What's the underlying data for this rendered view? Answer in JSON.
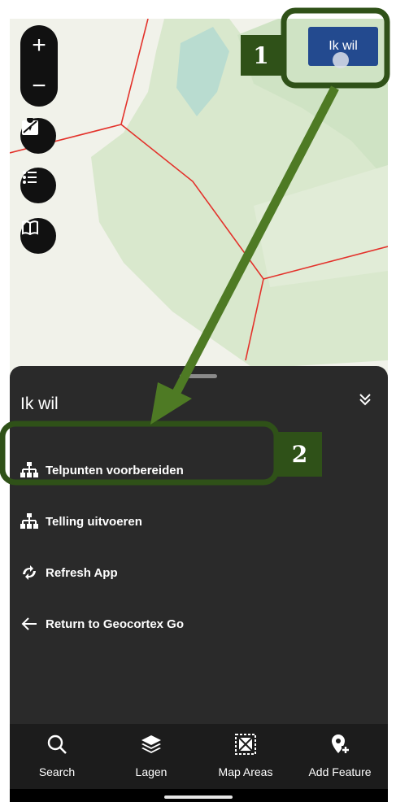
{
  "map": {
    "zoom_in_label": "+",
    "zoom_out_label": "−",
    "tools": [
      {
        "name": "map-marker-icon"
      },
      {
        "name": "legend-list-icon"
      },
      {
        "name": "book-icon"
      }
    ],
    "ik_wil_button": "Ik wil"
  },
  "panel": {
    "title": "Ik wil",
    "collapse_icon": "double-chevron-down",
    "items": [
      {
        "label": "Telpunten voorbereiden",
        "icon": "hierarchy-icon"
      },
      {
        "label": "Telling uitvoeren",
        "icon": "hierarchy-icon"
      },
      {
        "label": "Refresh App",
        "icon": "refresh-icon"
      },
      {
        "label": "Return to Geocortex Go",
        "icon": "arrow-left-icon"
      }
    ]
  },
  "tabs": [
    {
      "label": "Search",
      "icon": "search-icon"
    },
    {
      "label": "Lagen",
      "icon": "layers-icon"
    },
    {
      "label": "Map Areas",
      "icon": "map-areas-icon"
    },
    {
      "label": "Add Feature",
      "icon": "add-feature-icon"
    }
  ],
  "annotations": {
    "step1": "1",
    "step2": "2",
    "color": "#2f5118",
    "arrow_color": "#4e7a24"
  }
}
